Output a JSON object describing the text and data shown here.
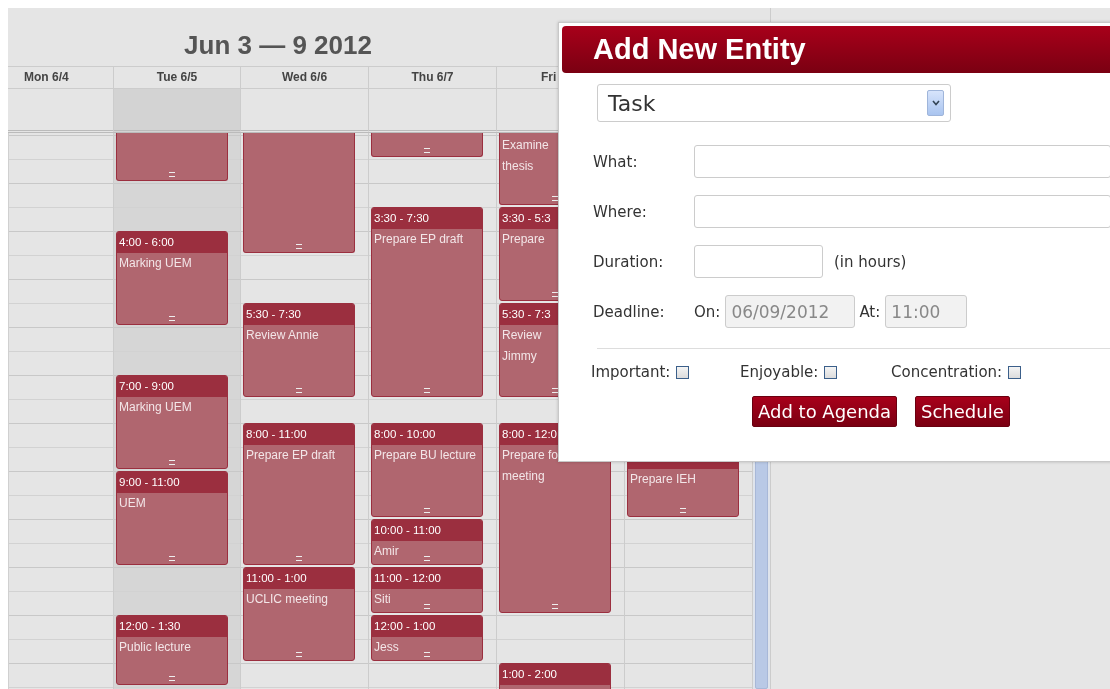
{
  "calendar": {
    "title": "Jun 3 — 9 2012",
    "days": [
      {
        "label": "Mon 6/4",
        "today": false
      },
      {
        "label": "Tue 6/5",
        "today": true,
        "events": [
          {
            "kind": "continued"
          },
          {
            "kind": "timed",
            "time": "4:00 - 6:00",
            "lines": [
              "Marking UEM"
            ]
          },
          {
            "kind": "timed",
            "time": "7:00 - 9:00",
            "lines": [
              "Marking UEM"
            ]
          },
          {
            "kind": "timed",
            "time": "9:00 - 11:00",
            "lines": [
              "UEM"
            ]
          },
          {
            "kind": "timed",
            "time": "12:00 - 1:30",
            "lines": [
              "Public lecture"
            ]
          }
        ]
      },
      {
        "label": "Wed 6/6",
        "today": false,
        "events": [
          {
            "kind": "continued"
          },
          {
            "kind": "timed",
            "time": "5:30 - 7:30",
            "lines": [
              "Review Annie"
            ]
          },
          {
            "kind": "timed",
            "time": "8:00 - 11:00",
            "lines": [
              "Prepare EP draft"
            ]
          },
          {
            "kind": "timed",
            "time": "11:00 - 1:00",
            "lines": [
              "UCLIC meeting"
            ]
          }
        ]
      },
      {
        "label": "Thu 6/7",
        "today": false,
        "events": [
          {
            "kind": "continued"
          },
          {
            "kind": "timed",
            "time": "3:30 - 7:30",
            "lines": [
              "Prepare EP draft"
            ]
          },
          {
            "kind": "timed",
            "time": "8:00 - 10:00",
            "lines": [
              "Prepare BU lecture"
            ]
          },
          {
            "kind": "timed",
            "time": "10:00 - 11:00",
            "lines": [
              "Amir"
            ]
          },
          {
            "kind": "timed",
            "time": "11:00 - 12:00",
            "lines": [
              "Siti"
            ]
          },
          {
            "kind": "timed",
            "time": "12:00 - 1:00",
            "lines": [
              "Jess"
            ]
          }
        ]
      },
      {
        "label": "Fri",
        "today": false,
        "events": [
          {
            "kind": "continued",
            "lines": [
              "Examine",
              "thesis"
            ]
          },
          {
            "kind": "timed",
            "time": "3:30 - 5:3",
            "lines": [
              "Prepare"
            ]
          },
          {
            "kind": "timed",
            "time": "5:30 - 7:3",
            "lines": [
              "Review",
              "Jimmy"
            ]
          },
          {
            "kind": "timed",
            "time": "8:00 - 12:0",
            "lines": [
              "Prepare fo",
              "meeting"
            ]
          },
          {
            "kind": "timed",
            "time": "1:00 - 2:00"
          }
        ]
      },
      {
        "today": false,
        "events": [
          {
            "kind": "timed",
            "lines": [
              "Prepare IEH"
            ]
          }
        ]
      }
    ]
  },
  "dialog": {
    "title": "Add New Entity",
    "type_select": {
      "value": "Task"
    },
    "fields": [
      {
        "label": "What:",
        "kind": "wide"
      },
      {
        "label": "Where:",
        "kind": "wide"
      },
      {
        "label": "Duration:",
        "kind": "short",
        "suffix": "(in hours)"
      }
    ],
    "deadline": {
      "label": "Deadline:",
      "on_label": "On:",
      "date": "06/09/2012",
      "at_label": "At:",
      "time": "11:00",
      "disabled": true
    },
    "flags": [
      {
        "label": "Important:",
        "checked": false
      },
      {
        "label": "Enjoyable:",
        "checked": false
      },
      {
        "label": "Concentration:",
        "checked": false
      }
    ],
    "buttons": [
      "Add to Agenda",
      "Schedule"
    ]
  }
}
